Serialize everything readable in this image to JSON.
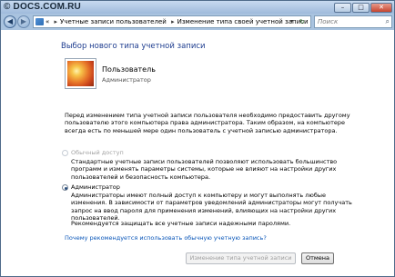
{
  "watermark": "© DOCS.COM.RU",
  "window": {
    "minimize_glyph": "–",
    "maximize_glyph": "□",
    "close_glyph": "✕"
  },
  "nav": {
    "back_glyph": "◀",
    "forward_glyph": "▶",
    "breadcrumb": [
      "«",
      "Учетные записи пользователей",
      "Изменение типа своей учетной записи"
    ],
    "separator": "▸",
    "dropdown_glyph": "▾",
    "refresh_glyph": "↻",
    "search_placeholder": "Поиск",
    "search_glyph": "⌕"
  },
  "page": {
    "heading": "Выбор нового типа учетной записи",
    "user": {
      "name": "Пользователь",
      "role": "Администратор"
    },
    "intro_text": "Перед изменением типа учетной записи пользователя необходимо предоставить другому пользователю этого компьютера права администратора. Таким образом, на компьютере всегда есть по меньшей мере один пользователь с учетной записью администратора.",
    "option_standard": {
      "label": "Обычный доступ",
      "description": "Стандартные учетные записи пользователей позволяют использовать большинство программ и изменять параметры системы, которые не влияют на настройки других пользователей и безопасность компьютера.",
      "selected": false,
      "enabled": false
    },
    "option_admin": {
      "label": "Администратор",
      "description": "Администраторы имеют полный доступ к компьютеру и могут выполнять любые изменения. В зависимости от параметров уведомлений администраторы могут получать запрос на ввод пароля для применения изменений, влияющих на настройки других пользователей.",
      "selected": true,
      "enabled": true
    },
    "recommendation": "Рекомендуется защищать все учетные записи надежными паролями.",
    "link_text": "Почему рекомендуется использовать обычную учетную запись?",
    "button_change": "Изменение типа учетной записи",
    "button_cancel": "Отмена"
  },
  "colors": {
    "heading": "#1e3d8f",
    "link": "#0b57b9",
    "disabled_text": "#a3a3a3",
    "chrome": "#a9c3df"
  }
}
